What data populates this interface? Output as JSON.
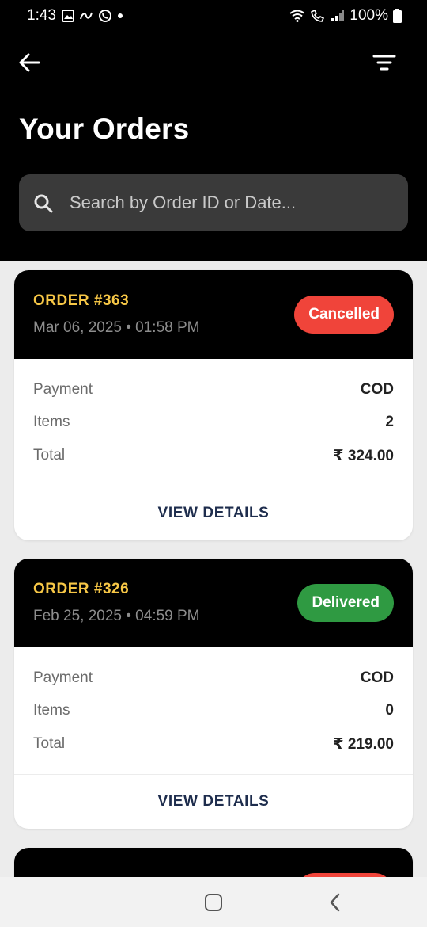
{
  "status_bar": {
    "time": "1:43",
    "battery": "100%"
  },
  "header": {
    "title": "Your Orders",
    "back_icon": "arrow-left-icon",
    "filter_icon": "filter-icon"
  },
  "search": {
    "placeholder": "Search by Order ID or Date..."
  },
  "labels": {
    "payment": "Payment",
    "items": "Items",
    "total": "Total",
    "view_details": "VIEW DETAILS"
  },
  "orders": [
    {
      "id": "ORDER #363",
      "date": "Mar 06, 2025 • 01:58 PM",
      "status": "Cancelled",
      "payment": "COD",
      "items": "2",
      "total": "₹ 324.00"
    },
    {
      "id": "ORDER #326",
      "date": "Feb 25, 2025 • 04:59 PM",
      "status": "Delivered",
      "payment": "COD",
      "items": "0",
      "total": "₹ 219.00"
    }
  ],
  "colors": {
    "header_bg": "#000000",
    "order_id": "#f7c746",
    "cancelled": "#f0443a",
    "delivered": "#2f9a42",
    "action_text": "#1e2d4d"
  }
}
